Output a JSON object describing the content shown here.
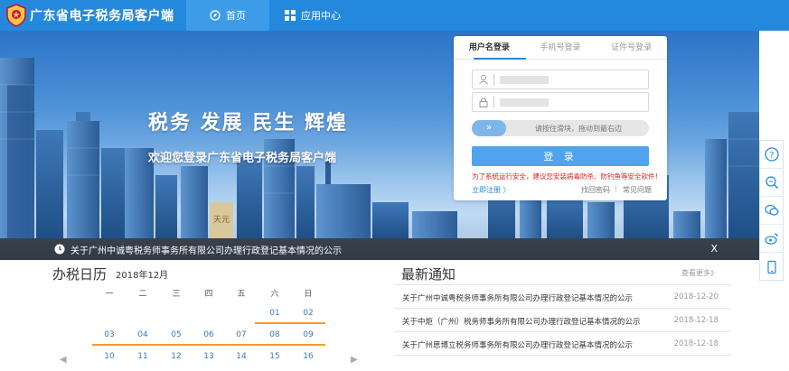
{
  "app": {
    "title": "广东省电子税务局客户端"
  },
  "nav": {
    "home": "首页",
    "apps": "应用中心"
  },
  "banner": {
    "slogan": "税务 发展 民生 辉煌",
    "welcome": "欢迎您登录广东省电子税务局客户端",
    "building_sign": "天元"
  },
  "notice_bar": {
    "text": "关于广州中诚粤税务师事务所有限公司办理行政登记基本情况的公示",
    "close": "X"
  },
  "login": {
    "tabs": [
      "用户名登录",
      "手机号登录",
      "证件号登录"
    ],
    "slider_handle": "»",
    "slider_text": "请按住滑块，拖动到最右边",
    "button": "登 录",
    "warning": "为了系统运行安全，建议您安装病毒防杀、防钓鱼等安全软件！",
    "register": "立即注册 〉",
    "find_password": "找回密码",
    "separator": "|",
    "faq": "常见问题"
  },
  "calendar": {
    "title": "办税日历",
    "month": "2018年12月",
    "weekdays": [
      "一",
      "二",
      "三",
      "四",
      "五",
      "六",
      "日"
    ],
    "row1": [
      "01",
      "02"
    ],
    "row2": [
      "03",
      "04",
      "05",
      "06",
      "07",
      "08",
      "09"
    ],
    "row3": [
      "10",
      "11",
      "12",
      "13",
      "14",
      "15",
      "16"
    ]
  },
  "news": {
    "title": "最新通知",
    "more": "查看更多》",
    "items": [
      {
        "title": "关于广州中诚粤税务师事务所有限公司办理行政登记基本情况的公示",
        "date": "2018-12-20"
      },
      {
        "title": "关于中炬（广州）税务师事务所有限公司办理行政登记基本情况的公示",
        "date": "2018-12-18"
      },
      {
        "title": "关于广州思博立税务师事务所有限公司办理行政登记基本情况的公示",
        "date": "2018-12-18"
      }
    ]
  },
  "float_bar": {
    "icons": [
      "help-icon",
      "search-icon",
      "chat-icon",
      "weibo-icon",
      "mobile-icon"
    ]
  },
  "colors": {
    "primary": "#2489dc",
    "accent": "#f0a020",
    "warning": "#e02020"
  }
}
